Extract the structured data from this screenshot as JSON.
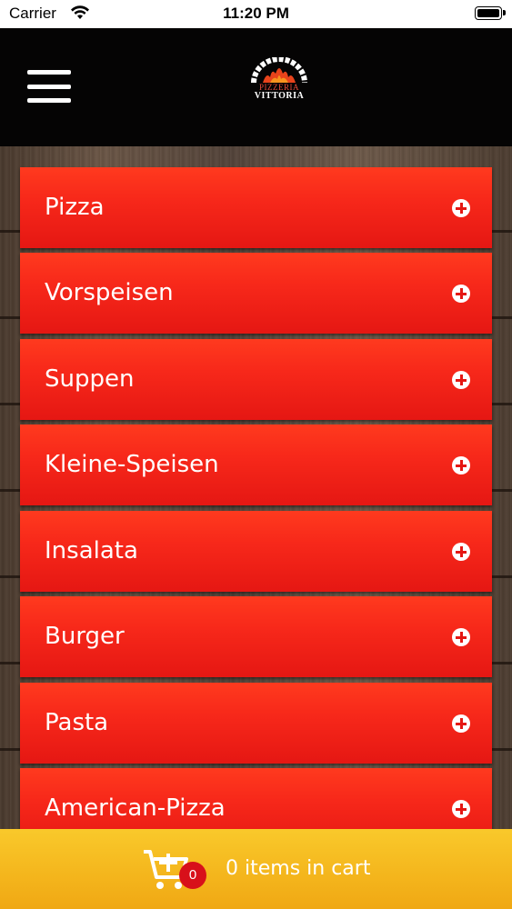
{
  "status_bar": {
    "carrier": "Carrier",
    "time": "11:20 PM"
  },
  "header": {
    "logo_line1": "PIZZERIA",
    "logo_line2": "VITTORIA"
  },
  "menu": {
    "items": [
      {
        "label": "Pizza"
      },
      {
        "label": "Vorspeisen"
      },
      {
        "label": "Suppen"
      },
      {
        "label": "Kleine-Speisen"
      },
      {
        "label": "Insalata"
      },
      {
        "label": "Burger"
      },
      {
        "label": "Pasta"
      },
      {
        "label": "American-Pizza"
      }
    ]
  },
  "cart": {
    "count": "0",
    "text": "0 items in cart"
  },
  "colors": {
    "header_bg": "#050404",
    "menu_item_red": "#f7281a",
    "cart_bar_yellow": "#f4b51c",
    "badge_red": "#d8101a"
  },
  "icons": {
    "menu": "hamburger-icon",
    "expand": "plus-circle-icon",
    "cart": "cart-add-icon",
    "wifi": "wifi-icon",
    "battery": "battery-icon"
  }
}
